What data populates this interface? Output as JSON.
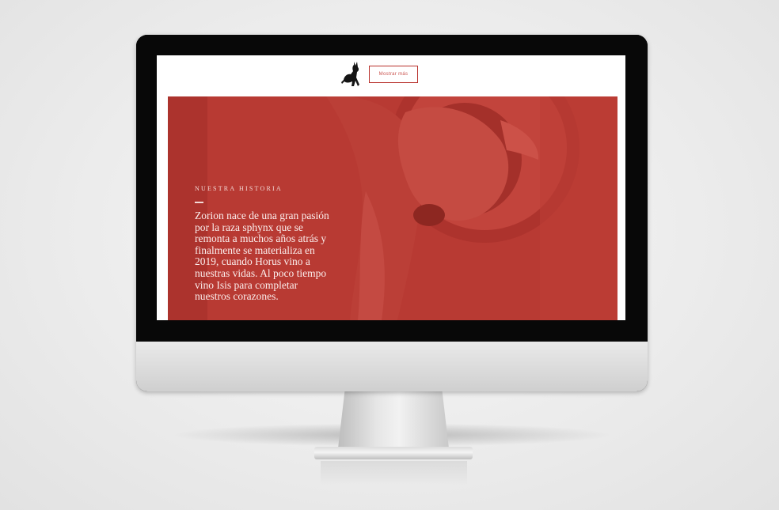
{
  "site": {
    "header": {
      "logo_icon": "sphynx-cat-logo-icon",
      "cta_label": "Mostrar más"
    },
    "hero": {
      "section_label": "NUESTRA HISTORIA",
      "story_lines": [
        "Zorion nace de una gran pasión",
        "por la raza sphynx que se",
        "remonta a muchos años atrás y",
        "finalmente se materializa en",
        "2019, cuando Horus vino a",
        "nuestras vidas. Al poco tiempo",
        "vino Isis para completar",
        "nuestros corazones."
      ],
      "background_image": "sphynx-cat-eating-from-bowl",
      "overlay_color": "#b83a33"
    }
  },
  "colors": {
    "brand_red": "#b83a33",
    "text_light": "#fbeeed",
    "bezel": "#080808",
    "chin": "#dadada"
  }
}
